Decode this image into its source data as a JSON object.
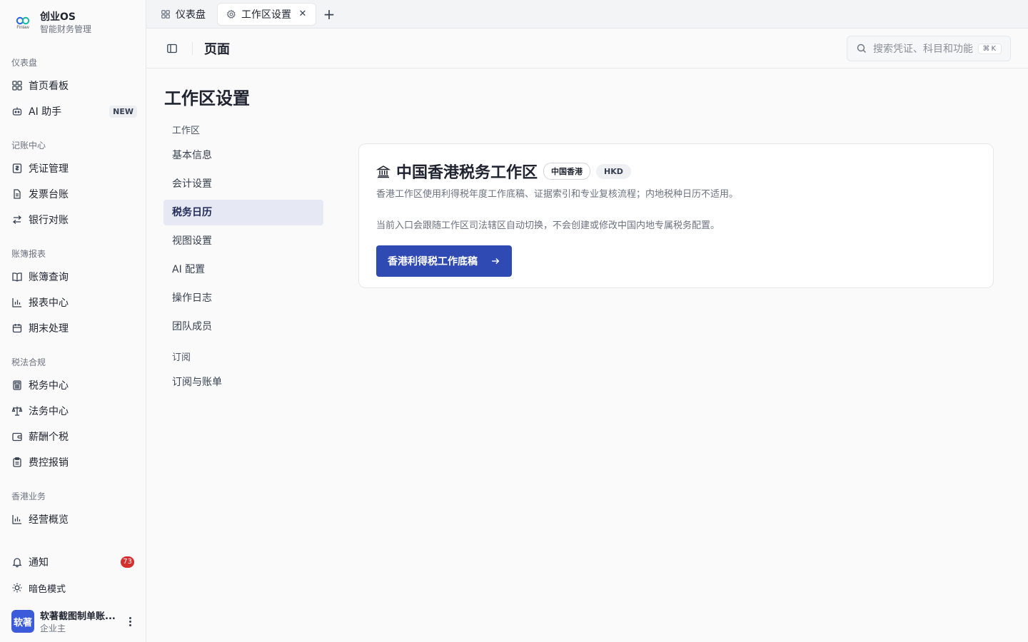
{
  "brand": {
    "name": "创业OS",
    "subtitle": "智能财务管理",
    "logo_word": "Finlaw"
  },
  "sidebar": {
    "groups": [
      {
        "title": "仪表盘",
        "items": [
          {
            "label": "首页看板",
            "icon": "grid-icon"
          },
          {
            "label": "AI 助手",
            "icon": "bot-icon",
            "badge": "NEW"
          }
        ]
      },
      {
        "title": "记账中心",
        "items": [
          {
            "label": "凭证管理",
            "icon": "voucher-icon"
          },
          {
            "label": "发票台账",
            "icon": "file-icon"
          },
          {
            "label": "银行对账",
            "icon": "swap-icon"
          }
        ]
      },
      {
        "title": "账簿报表",
        "items": [
          {
            "label": "账簿查询",
            "icon": "book-icon"
          },
          {
            "label": "报表中心",
            "icon": "bar-chart-icon"
          },
          {
            "label": "期末处理",
            "icon": "calendar-icon"
          }
        ]
      },
      {
        "title": "税法合规",
        "items": [
          {
            "label": "税务中心",
            "icon": "calculator-icon"
          },
          {
            "label": "法务中心",
            "icon": "scale-icon"
          },
          {
            "label": "薪酬个税",
            "icon": "wallet-icon"
          },
          {
            "label": "费控报销",
            "icon": "clipboard-icon"
          }
        ]
      },
      {
        "title": "香港业务",
        "items": [
          {
            "label": "经营概览",
            "icon": "bar-chart-icon"
          }
        ]
      }
    ],
    "notifications": {
      "label": "通知",
      "count": "73"
    },
    "dark_mode": {
      "label": "暗色模式"
    },
    "user": {
      "avatar": "软著",
      "name": "软著截图制单账...",
      "role": "企业主"
    }
  },
  "tabs": [
    {
      "label": "仪表盘",
      "icon": "grid-icon",
      "active": false
    },
    {
      "label": "工作区设置",
      "icon": "gear-icon",
      "active": true,
      "close": "✕"
    }
  ],
  "tab_add": "+",
  "header": {
    "page_label": "页面",
    "search_placeholder": "搜索凭证、科目和功能",
    "search_shortcut": "⌘K"
  },
  "settings": {
    "title": "工作区设置",
    "groups": [
      {
        "title": "工作区",
        "items": [
          "基本信息",
          "会计设置",
          "税务日历",
          "视图设置",
          "AI 配置",
          "操作日志",
          "团队成员"
        ]
      },
      {
        "title": "订阅",
        "items": [
          "订阅与账单"
        ]
      }
    ],
    "active_item": "税务日历"
  },
  "card": {
    "icon": "bank-icon",
    "title": "中国香港税务工作区",
    "region_pill": "中国香港",
    "currency_pill": "HKD",
    "description": "香港工作区使用利得税年度工作底稿、证据索引和专业复核流程；内地税种日历不适用。",
    "note": "当前入口会跟随工作区司法辖区自动切换，不会创建或修改中国内地专属税务配置。",
    "cta_label": "香港利得税工作底稿"
  },
  "colors": {
    "accent": "#2f4bb3",
    "active_nav_bg": "#e6e8f3",
    "badge_red": "#d32f2f",
    "avatar": "#3b5bdb"
  }
}
